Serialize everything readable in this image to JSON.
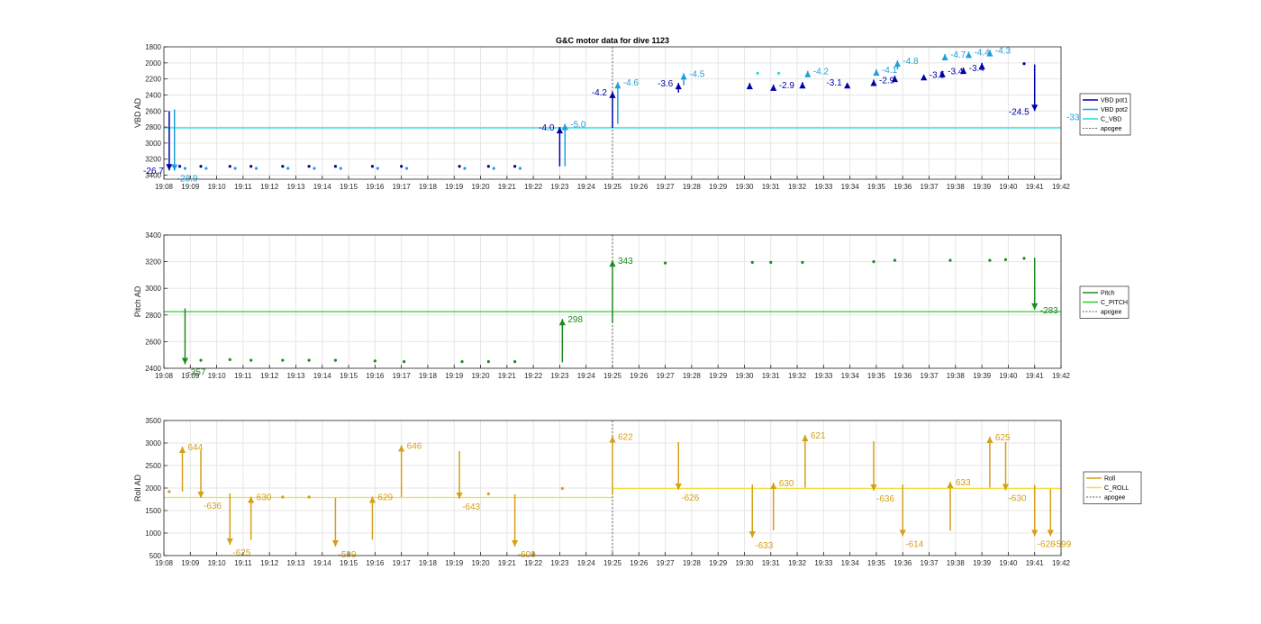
{
  "figure": {
    "title": "G&C motor data for dive 1123"
  },
  "colors": {
    "vbd1": "#0000a8",
    "vbd2": "#1e9fdc",
    "cvbd": "#22dede",
    "pitch": "#1f8a1f",
    "cpitch": "#33cc33",
    "roll": "#d4a017",
    "croll": "#f0e040",
    "apogee": "#666666",
    "grid": "#e6e6e6",
    "axis": "#262626"
  },
  "chart_data": [
    {
      "type": "line",
      "ylabel": "VBD AD",
      "xlim": [
        "19:08",
        "19:42"
      ],
      "ylim": [
        3450,
        1800
      ],
      "yticks": [
        1800,
        2000,
        2200,
        2400,
        2600,
        2800,
        3000,
        3200,
        3400
      ],
      "xticks": [
        "19:08",
        "19:09",
        "19:10",
        "19:11",
        "19:12",
        "19:13",
        "19:14",
        "19:15",
        "19:16",
        "19:17",
        "19:18",
        "19:19",
        "19:20",
        "19:21",
        "19:22",
        "19:23",
        "19:24",
        "19:25",
        "19:26",
        "19:27",
        "19:28",
        "19:29",
        "19:30",
        "19:31",
        "19:32",
        "19:33",
        "19:34",
        "19:35",
        "19:36",
        "19:37",
        "19:38",
        "19:39",
        "19:40",
        "19:41",
        "19:42"
      ],
      "grid": true,
      "legend": {
        "position": "right",
        "entries": [
          "VBD pot1",
          "VBD pot2",
          "C_VBD",
          "apogee"
        ]
      },
      "apogee": "19:25",
      "reference_lines": [
        {
          "name": "C_VBD",
          "segments": [
            {
              "x0": "19:08",
              "x1": "19:42",
              "y": 2810
            }
          ]
        }
      ],
      "moves": [
        {
          "series": "VBD pot1",
          "t": 8.2,
          "y0": 2600,
          "y1": 3340,
          "label": "-26.7",
          "side": "left"
        },
        {
          "series": "VBD pot2",
          "t": 8.4,
          "y0": 2580,
          "y1": 3345,
          "label": "-28.9",
          "side": "below"
        },
        {
          "series": "VBD pot1",
          "t": 23.0,
          "y0": 3290,
          "y1": 2800,
          "label": "-4.0",
          "side": "left"
        },
        {
          "series": "VBD pot2",
          "t": 23.2,
          "y0": 3290,
          "y1": 2760,
          "label": "-5.0",
          "side": "right"
        },
        {
          "series": "VBD pot1",
          "t": 25.0,
          "y0": 2810,
          "y1": 2360,
          "label": "-4.2",
          "side": "left"
        },
        {
          "series": "VBD pot2",
          "t": 25.2,
          "y0": 2760,
          "y1": 2240,
          "label": "-4.6",
          "side": "right"
        },
        {
          "series": "VBD pot1",
          "t": 27.5,
          "y0": 2370,
          "y1": 2250,
          "label": "-3.6",
          "side": "left"
        },
        {
          "series": "VBD pot2",
          "t": 27.7,
          "y0": 2280,
          "y1": 2130,
          "label": "-4.5",
          "side": "right"
        },
        {
          "series": "VBD pot1",
          "t": 30.2,
          "y0": 2300,
          "y1": 2250,
          "label": "",
          "side": "none"
        },
        {
          "series": "VBD pot1",
          "t": 31.1,
          "y0": 2280,
          "y1": 2270,
          "label": "-2.9",
          "side": "right"
        },
        {
          "series": "VBD pot1",
          "t": 32.2,
          "y0": 2280,
          "y1": 2240,
          "label": "",
          "side": "none"
        },
        {
          "series": "VBD pot2",
          "t": 32.4,
          "y0": 2150,
          "y1": 2100,
          "label": "-4.2",
          "side": "right"
        },
        {
          "series": "VBD pot1",
          "t": 33.9,
          "y0": 2240,
          "y1": 2240,
          "label": "-3.1",
          "side": "left"
        },
        {
          "series": "VBD pot1",
          "t": 34.9,
          "y0": 2270,
          "y1": 2210,
          "label": "-2.9",
          "side": "right"
        },
        {
          "series": "VBD pot2",
          "t": 35.0,
          "y0": 2140,
          "y1": 2080,
          "label": "-4.1",
          "side": "right"
        },
        {
          "series": "VBD pot1",
          "t": 35.7,
          "y0": 2230,
          "y1": 2160,
          "label": "",
          "side": "none"
        },
        {
          "series": "VBD pot2",
          "t": 35.8,
          "y0": 2080,
          "y1": 1970,
          "label": "-4.8",
          "side": "right"
        },
        {
          "series": "VBD pot1",
          "t": 36.8,
          "y0": 2140,
          "y1": 2140,
          "label": "-3.5",
          "side": "right"
        },
        {
          "series": "VBD pot1",
          "t": 37.5,
          "y0": 2160,
          "y1": 2100,
          "label": "-3.4",
          "side": "right"
        },
        {
          "series": "VBD pot2",
          "t": 37.6,
          "y0": 1960,
          "y1": 1890,
          "label": "-4.7",
          "side": "right"
        },
        {
          "series": "VBD pot1",
          "t": 38.3,
          "y0": 2090,
          "y1": 2060,
          "label": "-3.4",
          "side": "right"
        },
        {
          "series": "VBD pot2",
          "t": 38.5,
          "y0": 1910,
          "y1": 1860,
          "label": "-4.4",
          "side": "right"
        },
        {
          "series": "VBD pot1",
          "t": 39.0,
          "y0": 2070,
          "y1": 2000,
          "label": "",
          "side": "none"
        },
        {
          "series": "VBD pot2",
          "t": 39.3,
          "y0": 1880,
          "y1": 1840,
          "label": "-4.3",
          "side": "right"
        },
        {
          "series": "VBD pot1",
          "t": 41.0,
          "y0": 2020,
          "y1": 2600,
          "label": "-24.5",
          "side": "left"
        }
      ],
      "end_label": {
        "text": "-33",
        "y": 2680
      },
      "dots": [
        {
          "series": "VBD pot1",
          "t": 8.6,
          "y": 3290
        },
        {
          "series": "VBD pot2",
          "t": 8.8,
          "y": 3315
        },
        {
          "series": "VBD pot1",
          "t": 9.4,
          "y": 3290
        },
        {
          "series": "VBD pot2",
          "t": 9.6,
          "y": 3315
        },
        {
          "series": "VBD pot1",
          "t": 10.5,
          "y": 3290
        },
        {
          "series": "VBD pot2",
          "t": 10.7,
          "y": 3315
        },
        {
          "series": "VBD pot1",
          "t": 11.3,
          "y": 3290
        },
        {
          "series": "VBD pot2",
          "t": 11.5,
          "y": 3315
        },
        {
          "series": "VBD pot1",
          "t": 12.5,
          "y": 3290
        },
        {
          "series": "VBD pot2",
          "t": 12.7,
          "y": 3315
        },
        {
          "series": "VBD pot1",
          "t": 13.5,
          "y": 3290
        },
        {
          "series": "VBD pot2",
          "t": 13.7,
          "y": 3315
        },
        {
          "series": "VBD pot1",
          "t": 14.5,
          "y": 3290
        },
        {
          "series": "VBD pot2",
          "t": 14.7,
          "y": 3315
        },
        {
          "series": "VBD pot1",
          "t": 15.9,
          "y": 3290
        },
        {
          "series": "VBD pot2",
          "t": 16.1,
          "y": 3315
        },
        {
          "series": "VBD pot1",
          "t": 17.0,
          "y": 3290
        },
        {
          "series": "VBD pot2",
          "t": 17.2,
          "y": 3315
        },
        {
          "series": "VBD pot1",
          "t": 19.2,
          "y": 3290
        },
        {
          "series": "VBD pot2",
          "t": 19.4,
          "y": 3315
        },
        {
          "series": "VBD pot1",
          "t": 20.3,
          "y": 3290
        },
        {
          "series": "VBD pot2",
          "t": 20.5,
          "y": 3315
        },
        {
          "series": "VBD pot1",
          "t": 21.3,
          "y": 3290
        },
        {
          "series": "VBD pot2",
          "t": 21.5,
          "y": 3315
        },
        {
          "series": "C_VBD",
          "t": 30.5,
          "y": 2130
        },
        {
          "series": "C_VBD",
          "t": 31.3,
          "y": 2130
        },
        {
          "series": "VBD pot1",
          "t": 40.6,
          "y": 2010
        }
      ]
    },
    {
      "type": "line",
      "ylabel": "Pitch AD",
      "xlim": [
        "19:08",
        "19:42"
      ],
      "ylim": [
        2400,
        3400
      ],
      "yticks": [
        2400,
        2600,
        2800,
        3000,
        3200,
        3400
      ],
      "xticks": [
        "19:08",
        "19:09",
        "19:10",
        "19:11",
        "19:12",
        "19:13",
        "19:14",
        "19:15",
        "19:16",
        "19:17",
        "19:18",
        "19:19",
        "19:20",
        "19:21",
        "19:22",
        "19:23",
        "19:24",
        "19:25",
        "19:26",
        "19:27",
        "19:28",
        "19:29",
        "19:30",
        "19:31",
        "19:32",
        "19:33",
        "19:34",
        "19:35",
        "19:36",
        "19:37",
        "19:38",
        "19:39",
        "19:40",
        "19:41",
        "19:42"
      ],
      "grid": true,
      "legend": {
        "position": "right",
        "entries": [
          "Pitch",
          "C_PITCH",
          "apogee"
        ]
      },
      "apogee": "19:25",
      "reference_lines": [
        {
          "name": "C_PITCH",
          "segments": [
            {
              "x0": "19:08",
              "x1": "19:42",
              "y": 2825
            }
          ]
        }
      ],
      "moves": [
        {
          "series": "Pitch",
          "t": 8.8,
          "y0": 2850,
          "y1": 2430,
          "label": "-357",
          "side": "below"
        },
        {
          "series": "Pitch",
          "t": 23.1,
          "y0": 2445,
          "y1": 2770,
          "label": "298",
          "side": "right"
        },
        {
          "series": "Pitch",
          "t": 25.0,
          "y0": 2740,
          "y1": 3210,
          "label": "343",
          "side": "right"
        },
        {
          "series": "Pitch",
          "t": 41.0,
          "y0": 3230,
          "y1": 2840,
          "label": "-283",
          "side": "right"
        }
      ],
      "dots": [
        {
          "series": "Pitch",
          "t": 9.4,
          "y": 2460
        },
        {
          "series": "Pitch",
          "t": 10.5,
          "y": 2465
        },
        {
          "series": "Pitch",
          "t": 11.3,
          "y": 2460
        },
        {
          "series": "Pitch",
          "t": 12.5,
          "y": 2460
        },
        {
          "series": "Pitch",
          "t": 13.5,
          "y": 2460
        },
        {
          "series": "Pitch",
          "t": 14.5,
          "y": 2460
        },
        {
          "series": "Pitch",
          "t": 16.0,
          "y": 2455
        },
        {
          "series": "Pitch",
          "t": 17.1,
          "y": 2450
        },
        {
          "series": "Pitch",
          "t": 19.3,
          "y": 2450
        },
        {
          "series": "Pitch",
          "t": 20.3,
          "y": 2450
        },
        {
          "series": "Pitch",
          "t": 21.3,
          "y": 2450
        },
        {
          "series": "Pitch",
          "t": 27.0,
          "y": 3190
        },
        {
          "series": "Pitch",
          "t": 30.3,
          "y": 3195
        },
        {
          "series": "Pitch",
          "t": 31.0,
          "y": 3195
        },
        {
          "series": "Pitch",
          "t": 32.2,
          "y": 3195
        },
        {
          "series": "Pitch",
          "t": 34.9,
          "y": 3200
        },
        {
          "series": "Pitch",
          "t": 35.7,
          "y": 3210
        },
        {
          "series": "Pitch",
          "t": 37.8,
          "y": 3210
        },
        {
          "series": "Pitch",
          "t": 39.3,
          "y": 3210
        },
        {
          "series": "Pitch",
          "t": 39.9,
          "y": 3215
        },
        {
          "series": "Pitch",
          "t": 40.6,
          "y": 3225
        }
      ]
    },
    {
      "type": "line",
      "ylabel": "Roll AD",
      "xlim": [
        "19:08",
        "19:42"
      ],
      "ylim": [
        500,
        3500
      ],
      "yticks": [
        500,
        1000,
        1500,
        2000,
        2500,
        3000,
        3500
      ],
      "xticks": [
        "19:08",
        "19:09",
        "19:10",
        "19:11",
        "19:12",
        "19:13",
        "19:14",
        "19:15",
        "19:16",
        "19:17",
        "19:18",
        "19:19",
        "19:20",
        "19:21",
        "19:22",
        "19:23",
        "19:24",
        "19:25",
        "19:26",
        "19:27",
        "19:28",
        "19:29",
        "19:30",
        "19:31",
        "19:32",
        "19:33",
        "19:34",
        "19:35",
        "19:36",
        "19:37",
        "19:38",
        "19:39",
        "19:40",
        "19:41",
        "19:42"
      ],
      "grid": true,
      "legend": {
        "position": "right",
        "entries": [
          "Roll",
          "C_ROLL",
          "apogee"
        ]
      },
      "apogee": "19:25",
      "reference_lines": [
        {
          "name": "C_ROLL",
          "segments": [
            {
              "x0": "19:08",
              "x1": "19:25",
              "y": 1790
            },
            {
              "x0": "19:25",
              "x1": "19:42",
              "y": 1990
            }
          ]
        }
      ],
      "moves": [
        {
          "series": "Roll",
          "t": 8.7,
          "y0": 1920,
          "y1": 2920,
          "label": "644",
          "side": "right"
        },
        {
          "series": "Roll",
          "t": 9.4,
          "y0": 2840,
          "y1": 1780,
          "label": "-636",
          "side": "below"
        },
        {
          "series": "Roll",
          "t": 10.5,
          "y0": 1880,
          "y1": 740,
          "label": "-625",
          "side": "below"
        },
        {
          "series": "Roll",
          "t": 11.3,
          "y0": 850,
          "y1": 1810,
          "label": "630",
          "side": "right"
        },
        {
          "series": "Roll",
          "t": 14.5,
          "y0": 1780,
          "y1": 700,
          "label": "-599",
          "side": "below"
        },
        {
          "series": "Roll",
          "t": 15.9,
          "y0": 850,
          "y1": 1810,
          "label": "629",
          "side": "right"
        },
        {
          "series": "Roll",
          "t": 17.0,
          "y0": 1800,
          "y1": 2950,
          "label": "646",
          "side": "right"
        },
        {
          "series": "Roll",
          "t": 19.2,
          "y0": 2820,
          "y1": 1760,
          "label": "-643",
          "side": "below"
        },
        {
          "series": "Roll",
          "t": 21.3,
          "y0": 1860,
          "y1": 700,
          "label": "-609",
          "side": "below"
        },
        {
          "series": "Roll",
          "t": 25.0,
          "y0": 1850,
          "y1": 3150,
          "label": "622",
          "side": "right"
        },
        {
          "series": "Roll",
          "t": 27.5,
          "y0": 3020,
          "y1": 1960,
          "label": "-626",
          "side": "below"
        },
        {
          "series": "Roll",
          "t": 30.3,
          "y0": 2080,
          "y1": 900,
          "label": "-633",
          "side": "below"
        },
        {
          "series": "Roll",
          "t": 31.1,
          "y0": 1060,
          "y1": 2120,
          "label": "630",
          "side": "right"
        },
        {
          "series": "Roll",
          "t": 32.3,
          "y0": 2010,
          "y1": 3180,
          "label": "621",
          "side": "right"
        },
        {
          "series": "Roll",
          "t": 34.9,
          "y0": 3040,
          "y1": 1940,
          "label": "-636",
          "side": "below"
        },
        {
          "series": "Roll",
          "t": 36.0,
          "y0": 2080,
          "y1": 930,
          "label": "-614",
          "side": "below"
        },
        {
          "series": "Roll",
          "t": 37.8,
          "y0": 1050,
          "y1": 2140,
          "label": "633",
          "side": "right"
        },
        {
          "series": "Roll",
          "t": 39.3,
          "y0": 2010,
          "y1": 3140,
          "label": "625",
          "side": "right"
        },
        {
          "series": "Roll",
          "t": 39.9,
          "y0": 3030,
          "y1": 1950,
          "label": "-630",
          "side": "below"
        },
        {
          "series": "Roll",
          "t": 41.0,
          "y0": 2070,
          "y1": 930,
          "label": "-628",
          "side": "below"
        },
        {
          "series": "Roll",
          "t": 41.6,
          "y0": 1980,
          "y1": 930,
          "label": "-599",
          "side": "below"
        }
      ],
      "dots": [
        {
          "series": "Roll",
          "t": 8.2,
          "y": 1920
        },
        {
          "series": "Roll",
          "t": 12.5,
          "y": 1800
        },
        {
          "series": "Roll",
          "t": 13.5,
          "y": 1800
        },
        {
          "series": "Roll",
          "t": 20.3,
          "y": 1870
        },
        {
          "series": "Roll",
          "t": 23.1,
          "y": 1990
        }
      ]
    }
  ]
}
